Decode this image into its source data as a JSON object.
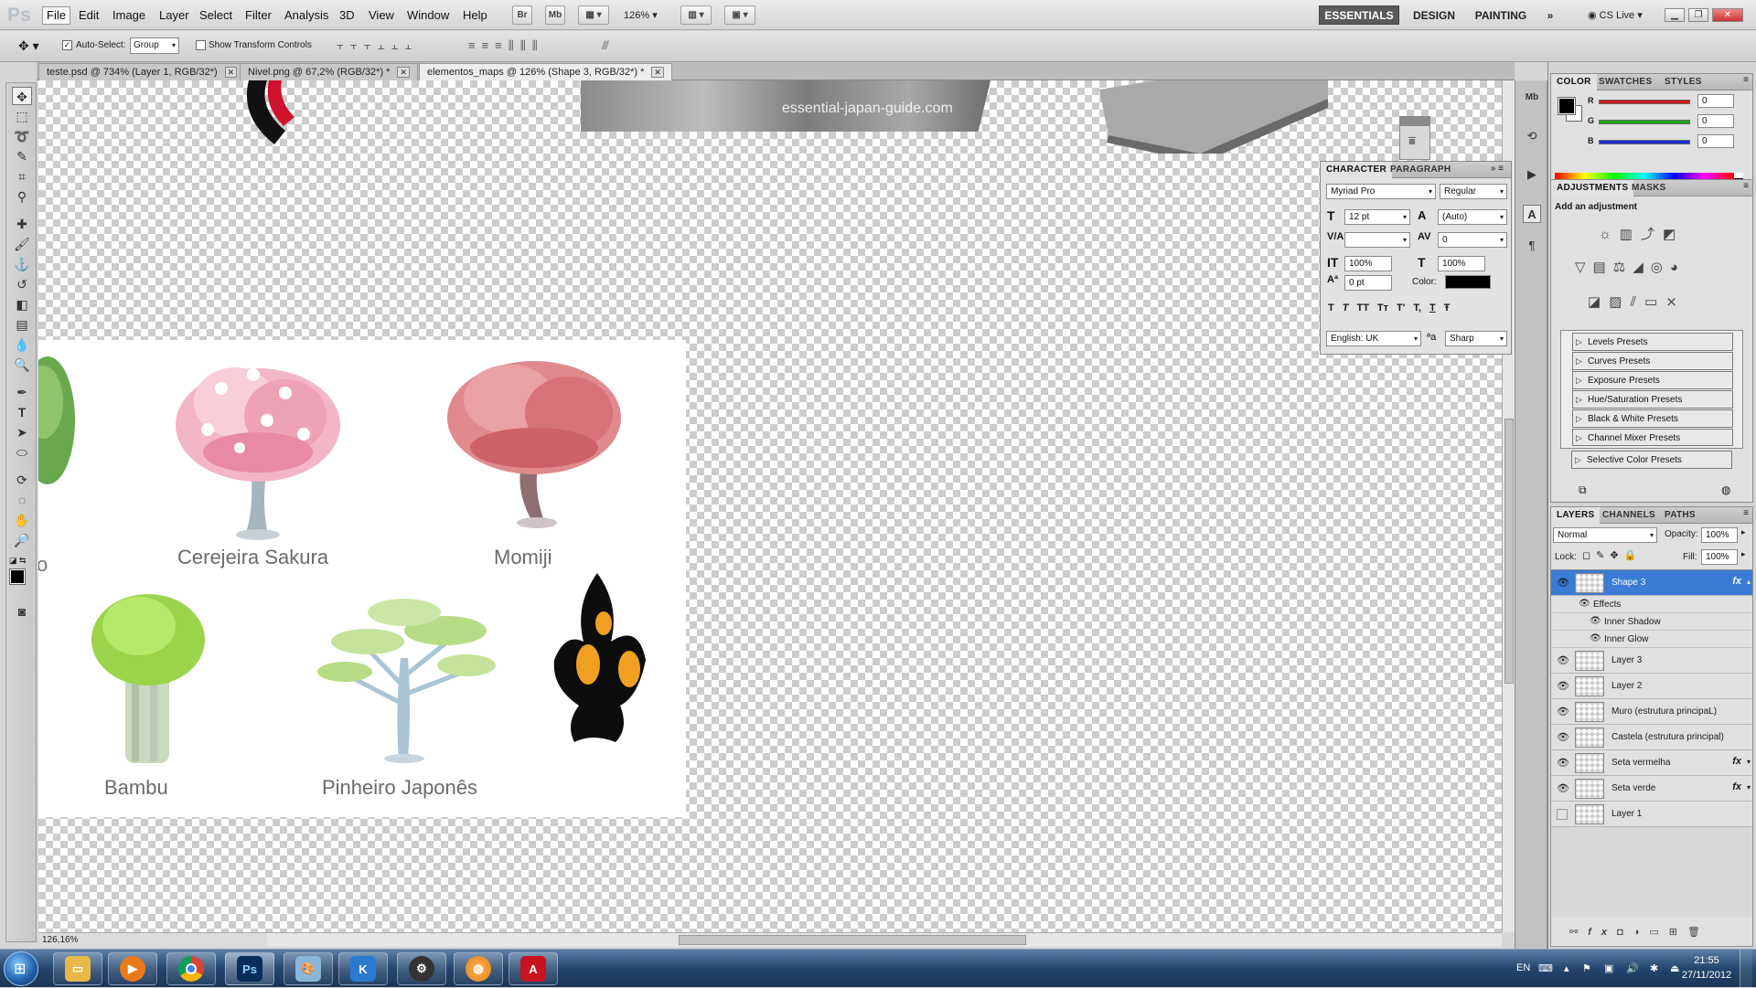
{
  "app": {
    "logo": "Ps"
  },
  "menu": [
    "File",
    "Edit",
    "Image",
    "Layer",
    "Select",
    "Filter",
    "Analysis",
    "3D",
    "View",
    "Window",
    "Help"
  ],
  "appbar": {
    "bridge": "Br",
    "minibridge": "Mb",
    "zoom": "126%"
  },
  "workspaces": [
    "ESSENTIALS",
    "DESIGN",
    "PAINTING"
  ],
  "cslive": "CS Live",
  "options": {
    "auto_select_label": "Auto-Select:",
    "auto_select_checked": true,
    "auto_select_mode": "Group",
    "show_transform_label": "Show Transform Controls",
    "show_transform_checked": false
  },
  "doc_tabs": [
    {
      "label": "teste.psd @ 734% (Layer 1, RGB/32*)",
      "active": false
    },
    {
      "label": "Nivel.png @ 67,2% (RGB/32*) *",
      "active": false
    },
    {
      "label": "elementos_maps @ 126% (Shape 3, RGB/32*) *",
      "active": true
    }
  ],
  "canvas": {
    "watermark": "essential-japan-guide.com",
    "labels": {
      "sakura": "Cerejeira Sakura",
      "momiji": "Momiji",
      "bambu": "Bambu",
      "pinheiro": "Pinheiro Japonês",
      "edge": "o"
    }
  },
  "character": {
    "tabs": [
      "CHARACTER",
      "PARAGRAPH"
    ],
    "font_family": "Myriad Pro",
    "font_style": "Regular",
    "size": "12 pt",
    "leading": "(Auto)",
    "kerning": "",
    "tracking": "0",
    "vscale": "100%",
    "hscale": "100%",
    "baseline": "0 pt",
    "color_label": "Color:",
    "color_value": "#000000",
    "style_buttons": [
      "T",
      "T",
      "TT",
      "Tт",
      "T'",
      "T,",
      "T",
      "Ŧ"
    ],
    "language": "English: UK",
    "aa_icon": "ªa",
    "antialias": "Sharp"
  },
  "color_panel": {
    "tabs": [
      "COLOR",
      "SWATCHES",
      "STYLES"
    ],
    "channels": [
      {
        "label": "R",
        "value": "0",
        "color": "#d41a1a"
      },
      {
        "label": "G",
        "value": "0",
        "color": "#1aa51a"
      },
      {
        "label": "B",
        "value": "0",
        "color": "#1a2fd4"
      }
    ]
  },
  "adjustments": {
    "tabs": [
      "ADJUSTMENTS",
      "MASKS"
    ],
    "title": "Add an adjustment",
    "presets": [
      "Levels Presets",
      "Curves Presets",
      "Exposure Presets",
      "Hue/Saturation Presets",
      "Black & White Presets",
      "Channel Mixer Presets",
      "Selective Color Presets"
    ]
  },
  "layers_panel": {
    "tabs": [
      "LAYERS",
      "CHANNELS",
      "PATHS"
    ],
    "blend_mode": "Normal",
    "opacity_label": "Opacity:",
    "opacity": "100%",
    "lock_label": "Lock:",
    "fill_label": "Fill:",
    "fill": "100%",
    "selected": "Shape 3",
    "effects_label": "Effects",
    "effects": [
      "Inner Shadow",
      "Inner Glow"
    ],
    "layers": [
      {
        "name": "Shape 3",
        "visible": true,
        "fx": true
      },
      {
        "name": "Layer 3",
        "visible": true,
        "fx": false
      },
      {
        "name": "Layer 2",
        "visible": true,
        "fx": false
      },
      {
        "name": "Muro (estrutura principaL)",
        "visible": true,
        "fx": false
      },
      {
        "name": "Castela (estrutura principal)",
        "visible": true,
        "fx": false
      },
      {
        "name": "Seta vermelha",
        "visible": true,
        "fx": true
      },
      {
        "name": "Seta verde",
        "visible": true,
        "fx": true
      },
      {
        "name": "Layer 1",
        "visible": false,
        "fx": false
      }
    ],
    "fx_symbol": "fx"
  },
  "status": {
    "zoom": "126,16%"
  },
  "taskbar": {
    "apps": [
      {
        "name": "file-explorer",
        "color": "#e8b84a"
      },
      {
        "name": "media-player",
        "color": "#e87a1a"
      },
      {
        "name": "chrome",
        "color": "#3a9a3a"
      },
      {
        "name": "photoshop",
        "label": "Ps",
        "color": "#0b2d5a"
      },
      {
        "name": "paint",
        "color": "#8ab4d8"
      },
      {
        "name": "app-k",
        "color": "#2a7ad0"
      },
      {
        "name": "steam",
        "color": "#333333"
      },
      {
        "name": "app-orange",
        "color": "#e8841a"
      },
      {
        "name": "adobe-reader",
        "color": "#c8141e"
      }
    ],
    "lang": "EN",
    "time": "21:55",
    "date": "27/11/2012"
  }
}
